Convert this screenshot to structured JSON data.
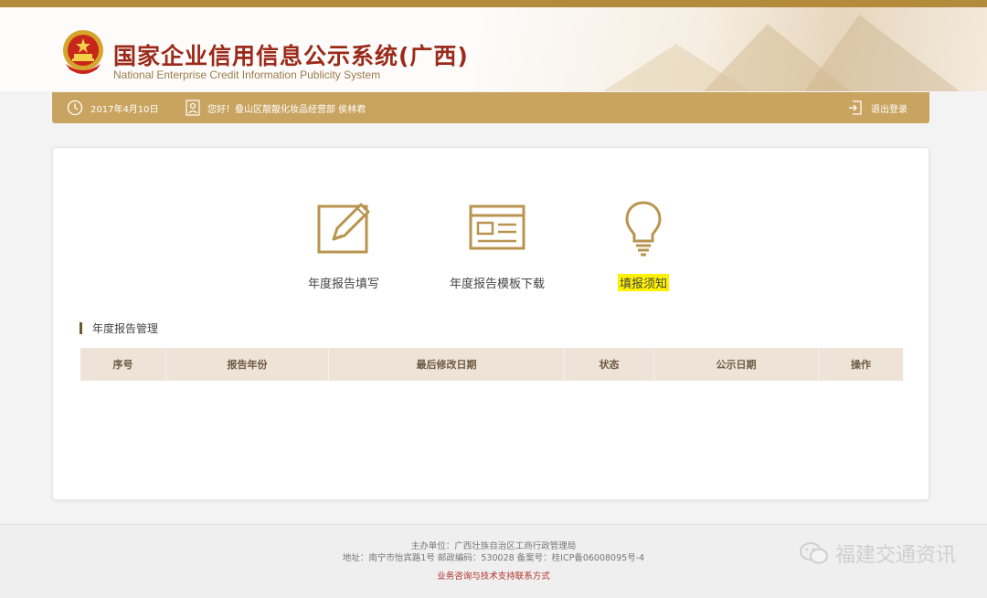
{
  "header": {
    "title": "国家企业信用信息公示系统(广西)",
    "subtitle": "National Enterprise Credit Information Publicity System"
  },
  "info_bar": {
    "date": "2017年4月10日",
    "greeting": "您好！叠山区靓靓化妆品经营部 侯林君",
    "logout": "退出登录"
  },
  "actions": [
    {
      "label": "年度报告填写",
      "icon": "pencil-edit-icon"
    },
    {
      "label": "年度报告模板下载",
      "icon": "template-download-icon"
    },
    {
      "label": "填报须知",
      "icon": "lightbulb-icon",
      "highlighted": true
    }
  ],
  "section": {
    "title": "年度报告管理"
  },
  "table": {
    "columns": [
      "序号",
      "报告年份",
      "最后修改日期",
      "状态",
      "公示日期",
      "操作"
    ]
  },
  "footer": {
    "line1": "主办单位：广西壮族自治区工商行政管理局",
    "line2": "地址：南宁市怡宾路1号 邮政编码：530028    备案号：桂ICP备06008095号-4",
    "line3": "业务咨询与技术支持联系方式"
  },
  "watermark": {
    "text": "福建交通资讯"
  },
  "colors": {
    "top_strip": "#b48a3c",
    "info_bar": "#c9a460",
    "icon_gold": "#b8944f",
    "title_red": "#9b2a1a",
    "table_header": "#ede3d7",
    "highlight": "#fff200"
  }
}
